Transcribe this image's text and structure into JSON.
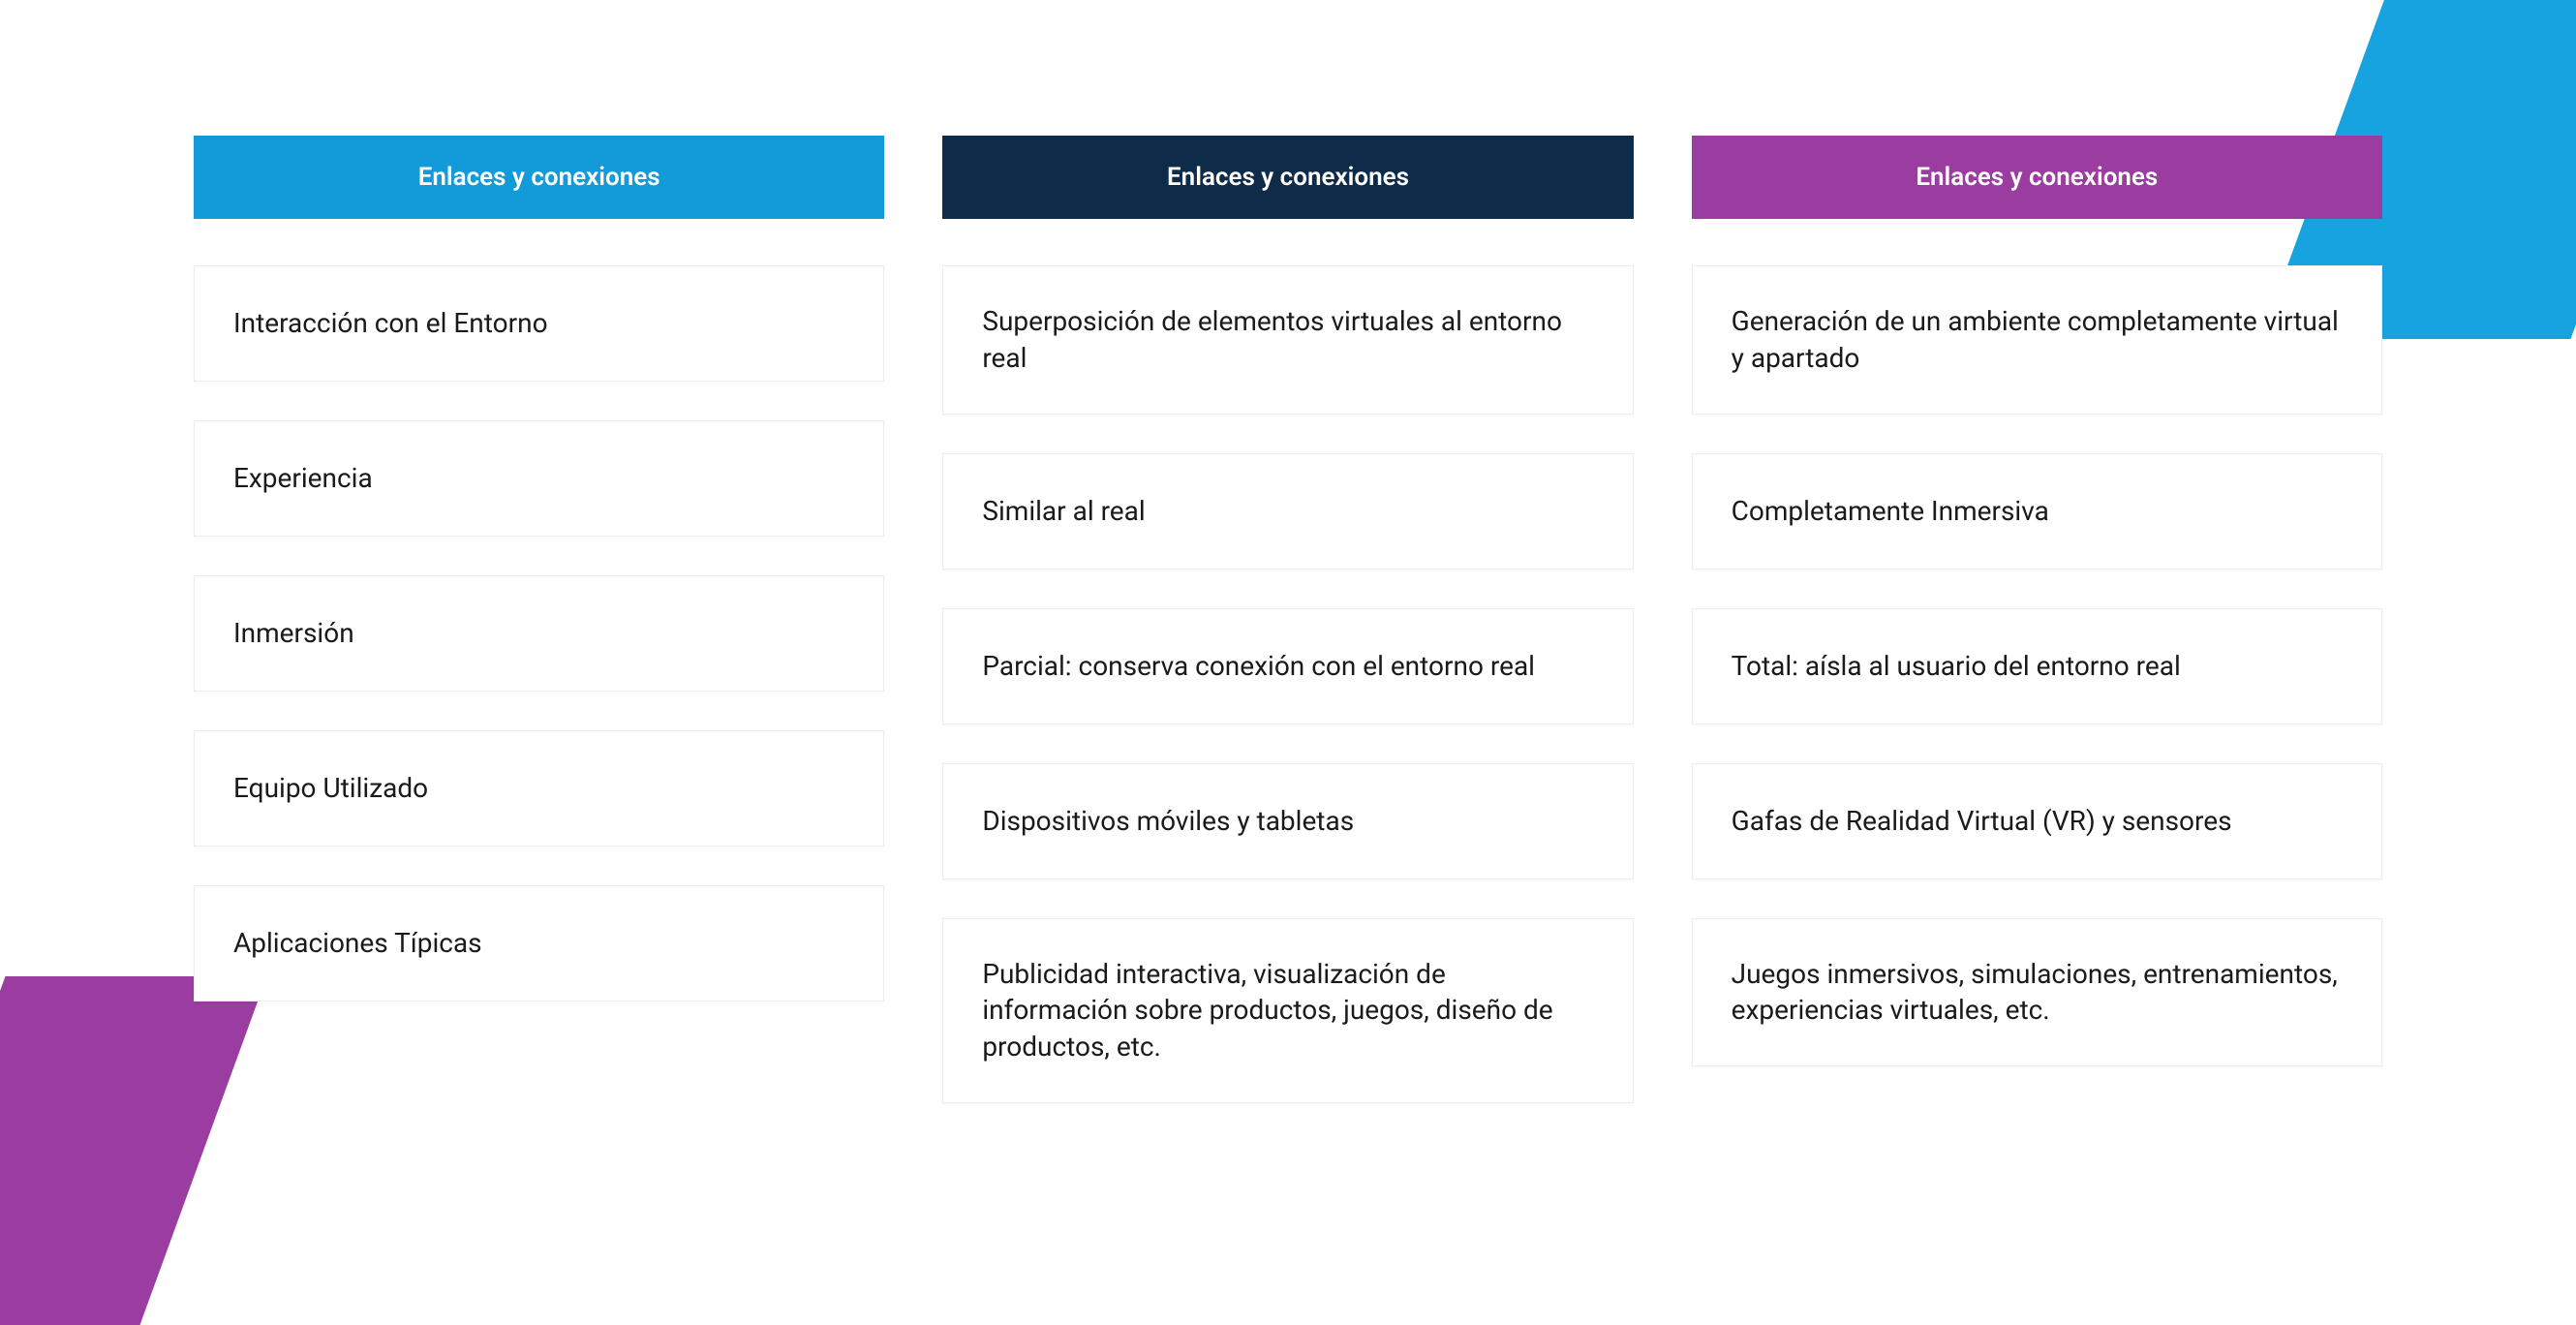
{
  "columns": [
    {
      "header": "Enlaces y conexiones",
      "color": "blue",
      "cells": [
        "Interacción con el Entorno",
        "Experiencia",
        "Inmersión",
        "Equipo Utilizado",
        "Aplicaciones Típicas"
      ]
    },
    {
      "header": "Enlaces y conexiones",
      "color": "navy",
      "cells": [
        "Superposición de elementos virtuales al entorno real",
        "Similar al real",
        "Parcial: conserva conexión con el entorno real",
        "Dispositivos móviles y tabletas",
        "Publicidad interactiva, visualización de información sobre productos, juegos, diseño de productos, etc."
      ]
    },
    {
      "header": "Enlaces y conexiones",
      "color": "purple",
      "cells": [
        "Generación de un ambiente completamente virtual y apartado",
        "Completamente Inmersiva",
        "Total: aísla al usuario del entorno real",
        "Gafas de Realidad Virtual (VR) y sensores",
        "Juegos inmersivos, simulaciones, entrenamientos, experiencias virtuales, etc."
      ]
    }
  ]
}
